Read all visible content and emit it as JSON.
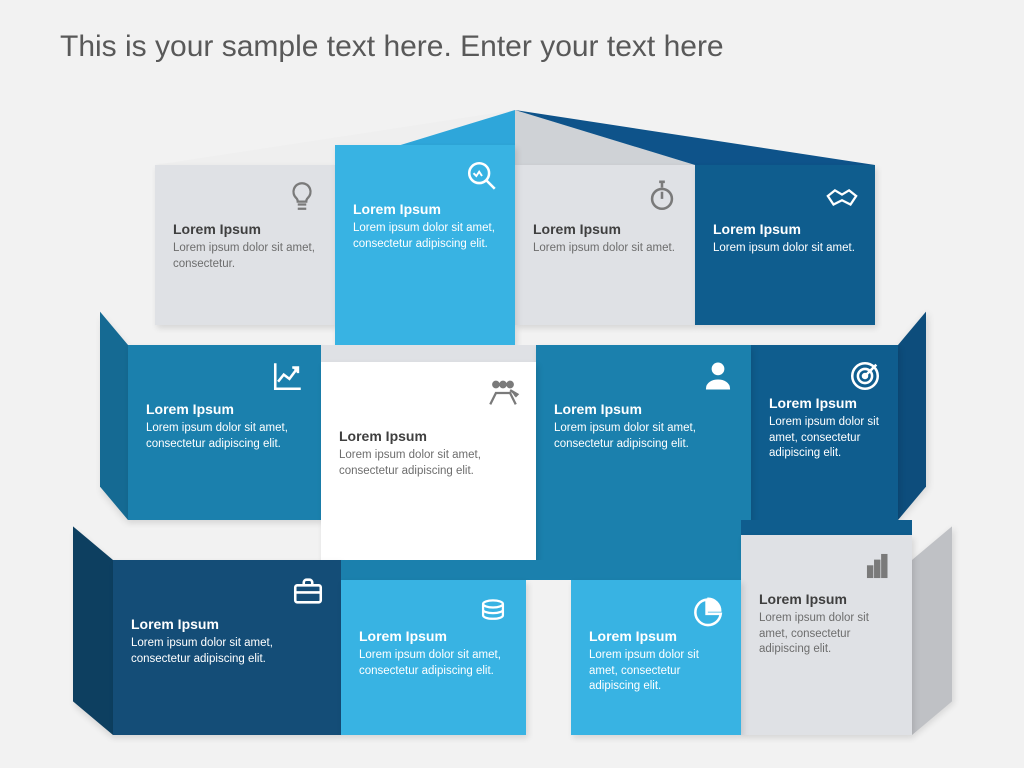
{
  "title": "This is your sample text here. Enter your text here",
  "colors": {
    "light": "#dfe1e5",
    "white": "#ffffff",
    "sky": "#38b3e3",
    "blue": "#1b80ad",
    "navy": "#0f5d8e",
    "deep": "#144d77"
  },
  "row1": [
    {
      "heading": "Lorem Ipsum",
      "body": "Lorem ipsum dolor sit amet, consectetur.",
      "icon": "bulb-icon",
      "color": "light"
    },
    {
      "heading": "Lorem Ipsum",
      "body": "Lorem ipsum dolor sit amet, consectetur adipiscing elit.",
      "icon": "magnifier-icon",
      "color": "sky"
    },
    {
      "heading": "Lorem Ipsum",
      "body": "Lorem ipsum dolor sit amet.",
      "icon": "stopwatch-icon",
      "color": "light"
    },
    {
      "heading": "Lorem Ipsum",
      "body": "Lorem ipsum dolor sit amet.",
      "icon": "handshake-icon",
      "color": "navy"
    }
  ],
  "row2": [
    {
      "heading": "Lorem Ipsum",
      "body": "Lorem ipsum dolor sit amet, consectetur adipiscing elit.",
      "icon": "growth-icon",
      "color": "blue"
    },
    {
      "heading": "Lorem Ipsum",
      "body": "Lorem ipsum dolor sit amet, consectetur adipiscing elit.",
      "icon": "team-icon",
      "color": "white"
    },
    {
      "heading": "Lorem Ipsum",
      "body": "Lorem ipsum dolor sit amet, consectetur adipiscing elit.",
      "icon": "person-icon",
      "color": "blue"
    },
    {
      "heading": "Lorem Ipsum",
      "body": "Lorem ipsum dolor sit amet, consectetur adipiscing elit.",
      "icon": "target-icon",
      "color": "navy"
    }
  ],
  "row3": [
    {
      "heading": "Lorem Ipsum",
      "body": "Lorem ipsum dolor sit amet, consectetur adipiscing elit.",
      "icon": "briefcase-icon",
      "color": "deep"
    },
    {
      "heading": "Lorem Ipsum",
      "body": "Lorem ipsum dolor sit amet, consectetur adipiscing elit.",
      "icon": "coins-icon",
      "color": "sky"
    },
    {
      "heading": "Lorem Ipsum",
      "body": "Lorem ipsum dolor sit amet, consectetur adipiscing elit.",
      "icon": "pie-icon",
      "color": "sky"
    },
    {
      "heading": "Lorem Ipsum",
      "body": "Lorem ipsum dolor sit amet, consectetur adipiscing elit.",
      "icon": "bars-icon",
      "color": "light"
    }
  ]
}
